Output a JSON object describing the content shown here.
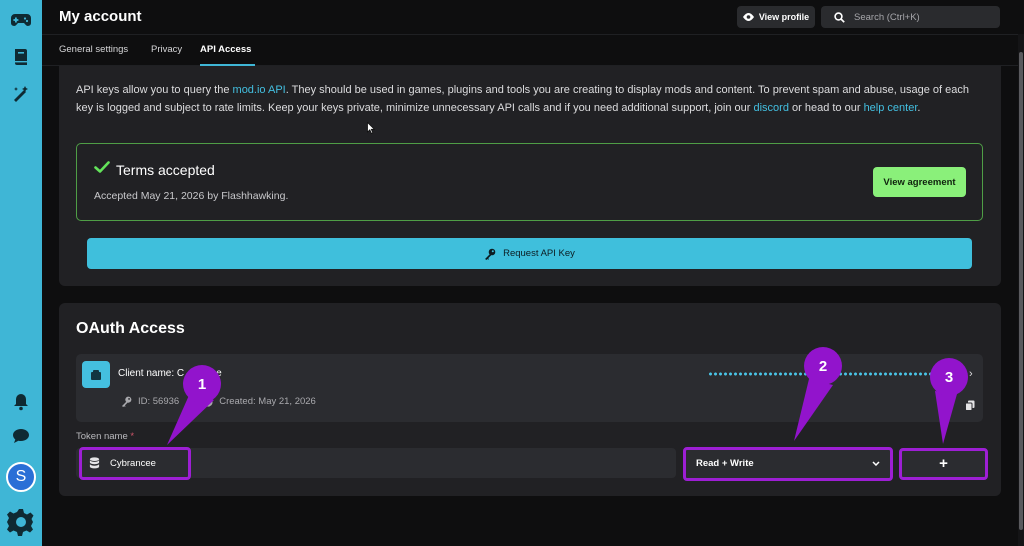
{
  "header": {
    "title": "My account",
    "view_profile_label": "View profile",
    "search_placeholder": "Search (Ctrl+K)"
  },
  "tabs": [
    {
      "label": "General settings",
      "active": false
    },
    {
      "label": "Privacy",
      "active": false
    },
    {
      "label": "API Access",
      "active": true
    }
  ],
  "api_access": {
    "intro_part1": "API keys allow you to query the ",
    "intro_link1": "mod.io API",
    "intro_part2": ". They should be used in games, plugins and tools you are creating to display mods and content. To prevent spam and abuse, usage of each key is logged and subject to rate limits. Keep your keys private, minimize unnecessary API calls and if you need additional support, join our ",
    "intro_link2": "discord",
    "intro_part3": " or head to our ",
    "intro_link3": "help center",
    "intro_part4": ".",
    "terms_title": "Terms accepted",
    "terms_accepted_text": "Accepted May 21, 2026 by Flashhawking.",
    "view_agreement_label": "View agreement",
    "request_key_label": "Request API Key"
  },
  "oauth": {
    "title": "OAuth Access",
    "client_name": "Client name: C",
    "client_name_tail": "e",
    "client_id": "ID: 56936",
    "client_created": "Created: May 21, 2026",
    "token_label": "Token name",
    "token_required_mark": "*",
    "token_value": "Cybrancee",
    "scope_value": "Read + Write",
    "add_label": "+"
  },
  "annotations": {
    "callout_1": "1",
    "callout_2": "2",
    "callout_3": "3",
    "color": "#9214cc"
  },
  "rail": {
    "avatar_letter": "S",
    "icons": [
      "gamepad-icon",
      "book-icon",
      "wand-icon",
      "bell-icon",
      "chat-icon",
      "settings-logo-icon"
    ]
  },
  "colors": {
    "accent": "#3fb6d6",
    "success": "#8af07a",
    "background": "#0e0e0f",
    "card": "#212124"
  }
}
